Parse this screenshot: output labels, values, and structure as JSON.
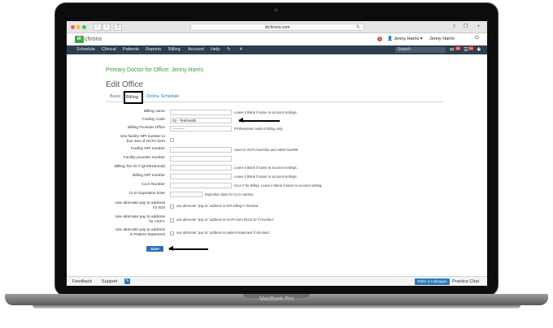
{
  "device": {
    "label": "MacBook Pro"
  },
  "browser": {
    "url": "drchrono.com",
    "colors": {
      "close": "#fc605b",
      "minimize": "#fdbc40",
      "maximize": "#34c84a"
    }
  },
  "app": {
    "logo_mark": "dr",
    "logo_text": "chrono",
    "notification_count": "3",
    "user_menu": "Jenny Harris",
    "user_name": "Jenny Harris",
    "colors": {
      "brand": "#3fa33f",
      "navbar": "#2d3e50",
      "link": "#2a7bbf"
    }
  },
  "nav": {
    "items": [
      "Schedule",
      "Clinical",
      "Patients",
      "Reports",
      "Billing",
      "Account",
      "Help"
    ],
    "search_placeholder": "Search",
    "messages_count": "28",
    "tasks_count": "24"
  },
  "page": {
    "title": "Primary Doctor for Office: Jenny Harris",
    "heading": "Edit Office",
    "tabs": [
      "Basic",
      "Billing",
      "Online Schedule"
    ],
    "active_tab": "Billing"
  },
  "form": {
    "fields": [
      {
        "label": "Billing name",
        "value": "",
        "hint": "Leave it blank if same to account settings."
      },
      {
        "label": "Facility Code",
        "value": "02 - Telehealth",
        "hint": ""
      },
      {
        "label": "Billing Provider Office",
        "value": "----------",
        "hint": "Professional medical billing only."
      },
      {
        "label": "Use facility NPI number in box 32a of HCFA form",
        "checkbox": true
      },
      {
        "label": "Facility NPI number",
        "value": "",
        "hint": "Used in HCFA box#32a and UB04 box#56"
      },
      {
        "label": "Facility provider number",
        "value": "",
        "hint": ""
      },
      {
        "label": "Billing Tax ID # (professional)",
        "value": "",
        "hint": "Leave it blank if same to account settings."
      },
      {
        "label": "Billing NPI number",
        "value": "",
        "hint": "Leave it blank if same to account settings."
      },
      {
        "label": "CLIA Number",
        "value": "",
        "hint": "CLIA # for billing. Leave it blank if same to account setting."
      },
      {
        "label": "CLIA Expiration Date",
        "value": "",
        "hint": "Expiration date for CLIA number."
      }
    ],
    "checkboxes": [
      {
        "label": "Use alternate pay to address for EDI",
        "hint": "use alternate \"pay to\" address in EDI billing if checked."
      },
      {
        "label": "Use alternate pay to address for HCFA",
        "hint": "use alternate \"pay to\" address in HCFA form block 33 if checked."
      },
      {
        "label": "Use alternate pay to address in Patient Statement",
        "hint": "use alternate \"pay to\" address in patient statement if checked."
      }
    ],
    "save_label": "Save"
  },
  "footer": {
    "feedback": "Feedback",
    "support": "Support",
    "refer": "Refer a Colleague",
    "chat": "Practice Chat"
  }
}
